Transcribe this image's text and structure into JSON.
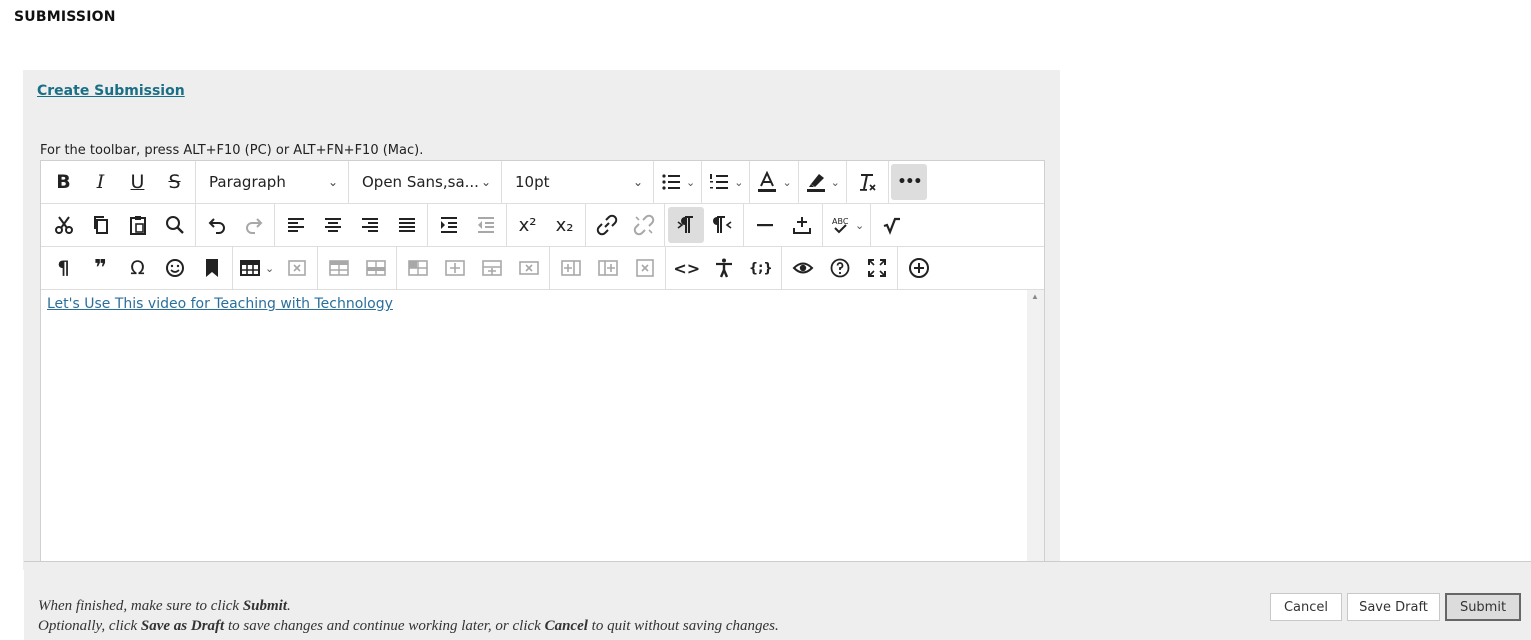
{
  "page_heading": "SUBMISSION",
  "create_link": "Create Submission",
  "toolbar_hint": "For the toolbar, press ALT+F10 (PC) or ALT+FN+F10 (Mac).",
  "format_select": "Paragraph",
  "font_select": "Open Sans,sa...",
  "size_select": "10pt",
  "content_link": "Let's Use This video for Teaching with Technology",
  "footer": {
    "line1_a": "When finished, make sure to click ",
    "line1_b": "Submit",
    "line1_c": ".",
    "line2_a": "Optionally, click ",
    "line2_b": "Save as Draft",
    "line2_c": " to save changes and continue working later, or click ",
    "line2_d": "Cancel",
    "line2_e": " to quit without saving changes."
  },
  "buttons": {
    "cancel": "Cancel",
    "save_draft": "Save Draft",
    "submit": "Submit"
  },
  "icons": {
    "bold": "B",
    "italic": "I",
    "underline": "U",
    "strike": "S",
    "more": "•••",
    "paragraph_mark": "¶",
    "quote": "❞",
    "omega": "Ω",
    "superscript": "x²",
    "subscript": "x₂",
    "code": "<>",
    "math": "{;}"
  }
}
